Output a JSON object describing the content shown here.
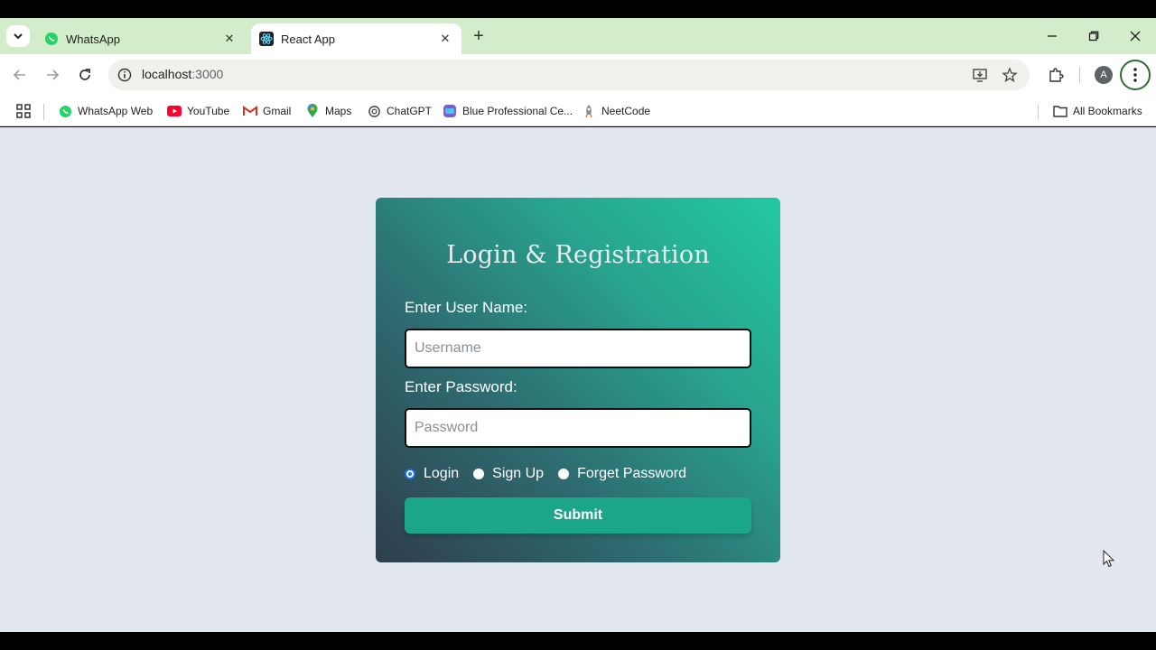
{
  "browser": {
    "tabs": [
      {
        "title": "WhatsApp",
        "favicon": "whatsapp-icon",
        "active": false
      },
      {
        "title": "React App",
        "favicon": "react-icon",
        "active": true
      }
    ],
    "address": {
      "host": "localhost",
      "port": ":3000"
    },
    "bookmarks": [
      {
        "label": "WhatsApp Web",
        "icon": "whatsapp-icon"
      },
      {
        "label": "YouTube",
        "icon": "youtube-icon"
      },
      {
        "label": "Gmail",
        "icon": "gmail-icon"
      },
      {
        "label": "Maps",
        "icon": "maps-icon"
      },
      {
        "label": "ChatGPT",
        "icon": "chatgpt-icon"
      },
      {
        "label": "Blue Professional Ce...",
        "icon": "canva-icon"
      },
      {
        "label": "NeetCode",
        "icon": "neetcode-icon"
      }
    ],
    "all_bookmarks": "All Bookmarks",
    "profile_initial": "A"
  },
  "form": {
    "title": "Login & Registration",
    "username_label": "Enter User Name:",
    "username_placeholder": "Username",
    "username_value": "",
    "password_label": "Enter Password:",
    "password_placeholder": "Password",
    "password_value": "",
    "options": [
      {
        "label": "Login",
        "checked": true
      },
      {
        "label": "Sign Up",
        "checked": false
      },
      {
        "label": "Forget Password",
        "checked": false
      }
    ],
    "submit_label": "Submit"
  },
  "colors": {
    "page_bg": "#e3e8f0",
    "card_gradient_start": "#2f3e4d",
    "card_gradient_end": "#22c9a0",
    "submit_bg": "#1ba589",
    "tabstrip_bg": "#d3ecc9"
  }
}
